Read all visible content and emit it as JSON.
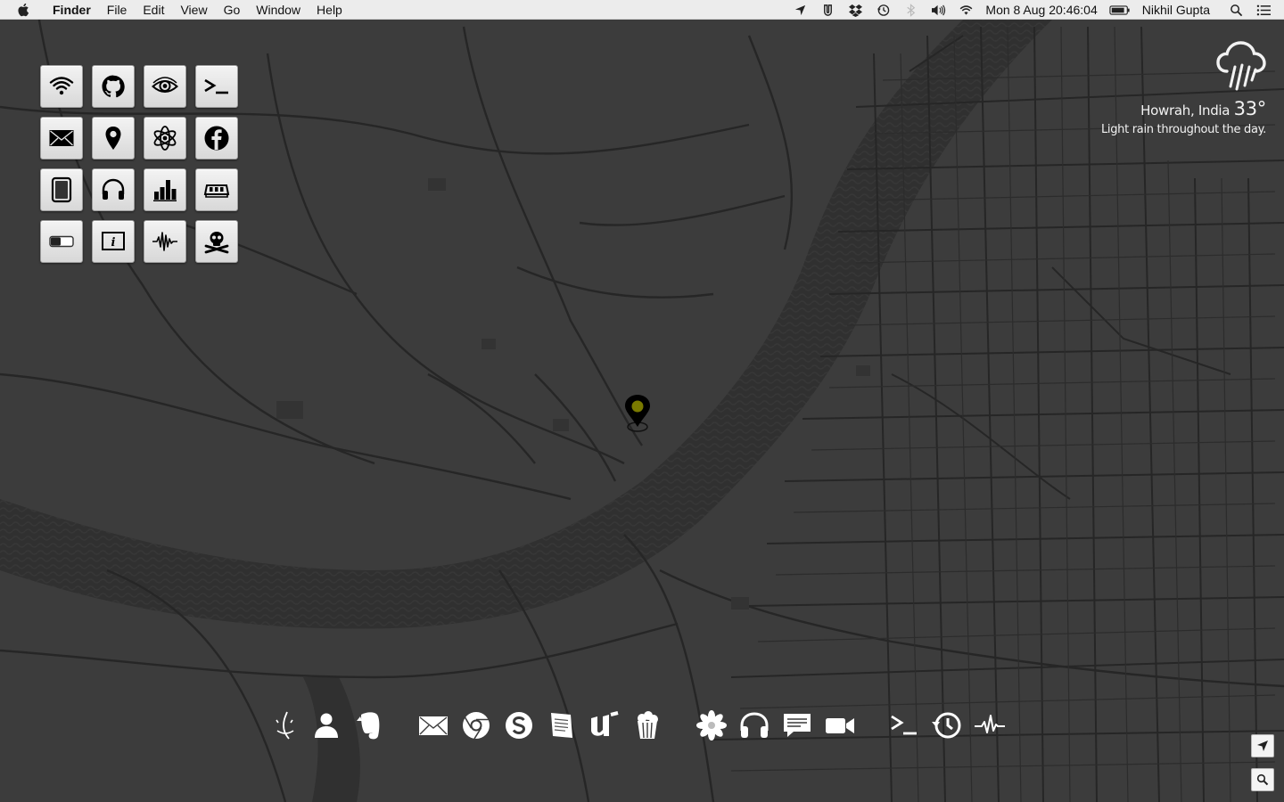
{
  "menubar": {
    "app_name": "Finder",
    "menus": [
      "File",
      "Edit",
      "View",
      "Go",
      "Window",
      "Help"
    ],
    "status_icons": [
      "location-icon",
      "utorrent-icon",
      "dropbox-icon",
      "time-machine-icon",
      "bluetooth-icon",
      "volume-icon",
      "wifi-icon"
    ],
    "datetime": "Mon 8 Aug  20:46:04",
    "user": "Nikhil Gupta"
  },
  "widget_grid": {
    "tiles": [
      {
        "icon": "wifi-icon"
      },
      {
        "icon": "github-icon"
      },
      {
        "icon": "eye-icon"
      },
      {
        "icon": "terminal-icon"
      },
      {
        "icon": "mail-icon"
      },
      {
        "icon": "map-pin-icon"
      },
      {
        "icon": "atom-icon"
      },
      {
        "icon": "facebook-icon"
      },
      {
        "icon": "tablet-icon"
      },
      {
        "icon": "headphones-icon"
      },
      {
        "icon": "bar-chart-icon"
      },
      {
        "icon": "memory-icon"
      },
      {
        "icon": "battery-icon"
      },
      {
        "icon": "info-icon"
      },
      {
        "icon": "waveform-icon"
      },
      {
        "icon": "skull-crossbones-icon"
      }
    ]
  },
  "weather": {
    "location": "Howrah, India",
    "temperature": "33°",
    "summary": "Light rain throughout the day."
  },
  "dock": {
    "items": [
      "finder-icon",
      "contacts-icon",
      "evernote-icon",
      "mail-icon",
      "chrome-icon",
      "skype-icon",
      "notes-icon",
      "utorrent-icon",
      "popcorn-icon",
      "photos-icon",
      "headphones-icon",
      "messages-icon",
      "facetime-icon",
      "terminal-icon",
      "time-machine-icon",
      "activity-monitor-icon"
    ]
  },
  "colors": {
    "map_background": "#3a3a3a",
    "map_roads": "#262626",
    "river": "#2f2f2f",
    "pin_accent": "#7a7a00",
    "menubar": "#ececec"
  }
}
